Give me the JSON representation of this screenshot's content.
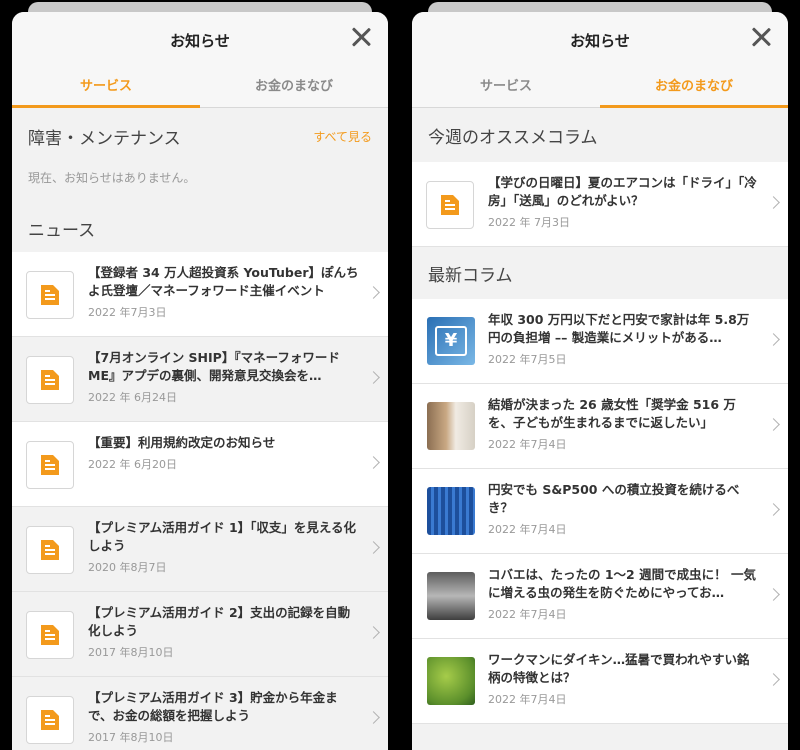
{
  "left": {
    "title": "お知らせ",
    "tabs": [
      "サービス",
      "お金のまなび"
    ],
    "active_tab": 0,
    "maintenance": {
      "heading": "障害・メンテナンス",
      "see_all": "すべて見る",
      "empty": "現在、お知らせはありません。"
    },
    "news_heading": "ニュース",
    "items": [
      {
        "title": "【登録者 34 万人超投資系 YouTuber】ぽんちよ氏登壇／マネーフォワード主催イベント",
        "date": "2022 年7月3日",
        "bg": "white"
      },
      {
        "title": "【7月オンライン SHIP】『マネーフォワード ME』アプデの裏側、開発意見交換会を…",
        "date": "2022 年 6月24日",
        "bg": "grey"
      },
      {
        "title": "【重要】利用規約改定のお知らせ",
        "date": "2022 年 6月20日",
        "bg": "white"
      },
      {
        "title": "【プレミアム活用ガイド 1】「収支」を見える化しよう",
        "date": "2020 年8月7日",
        "bg": "grey"
      },
      {
        "title": "【プレミアム活用ガイド 2】支出の記録を自動化しよう",
        "date": "2017 年8月10日",
        "bg": "grey"
      },
      {
        "title": "【プレミアム活用ガイド 3】貯金から年金まで、お金の総額を把握しよう",
        "date": "2017 年8月10日",
        "bg": "grey"
      }
    ]
  },
  "right": {
    "title": "お知らせ",
    "tabs": [
      "サービス",
      "お金のまなび"
    ],
    "active_tab": 1,
    "weekly_heading": "今週のオススメコラム",
    "featured": {
      "title": "【学びの日曜日】夏のエアコンは「ドライ」「冷房」「送風」のどれがよい？",
      "date": "2022 年 7月3日"
    },
    "latest_heading": "最新コラム",
    "items": [
      {
        "title": "年収 300 万円以下だと円安で家計は年 5.8万円の負担増 –– 製造業にメリットがある…",
        "date": "2022 年7月5日",
        "thumb": "yen-sign-image",
        "thumb_text": "¥"
      },
      {
        "title": "結婚が決まった 26 歳女性「奨学金 516 万を、子どもが生まれるまでに返したい」",
        "date": "2022 年7月4日",
        "thumb": "woman-photo",
        "thumb_text": ""
      },
      {
        "title": "円安でも S&P500 への積立投資を続けるべき？",
        "date": "2022 年7月4日",
        "thumb": "skyscraper-photo",
        "thumb_text": ""
      },
      {
        "title": "コバエは、たったの 1〜2 週間で成虫に！ 一気に増える虫の発生を防ぐためにやってお…",
        "date": "2022 年7月4日",
        "thumb": "kitchen-sink-photo",
        "thumb_text": ""
      },
      {
        "title": "ワークマンにダイキン…猛暑で買われやすい銘柄の特徴とは？",
        "date": "2022 年7月4日",
        "thumb": "plant-photo",
        "thumb_text": ""
      }
    ]
  }
}
